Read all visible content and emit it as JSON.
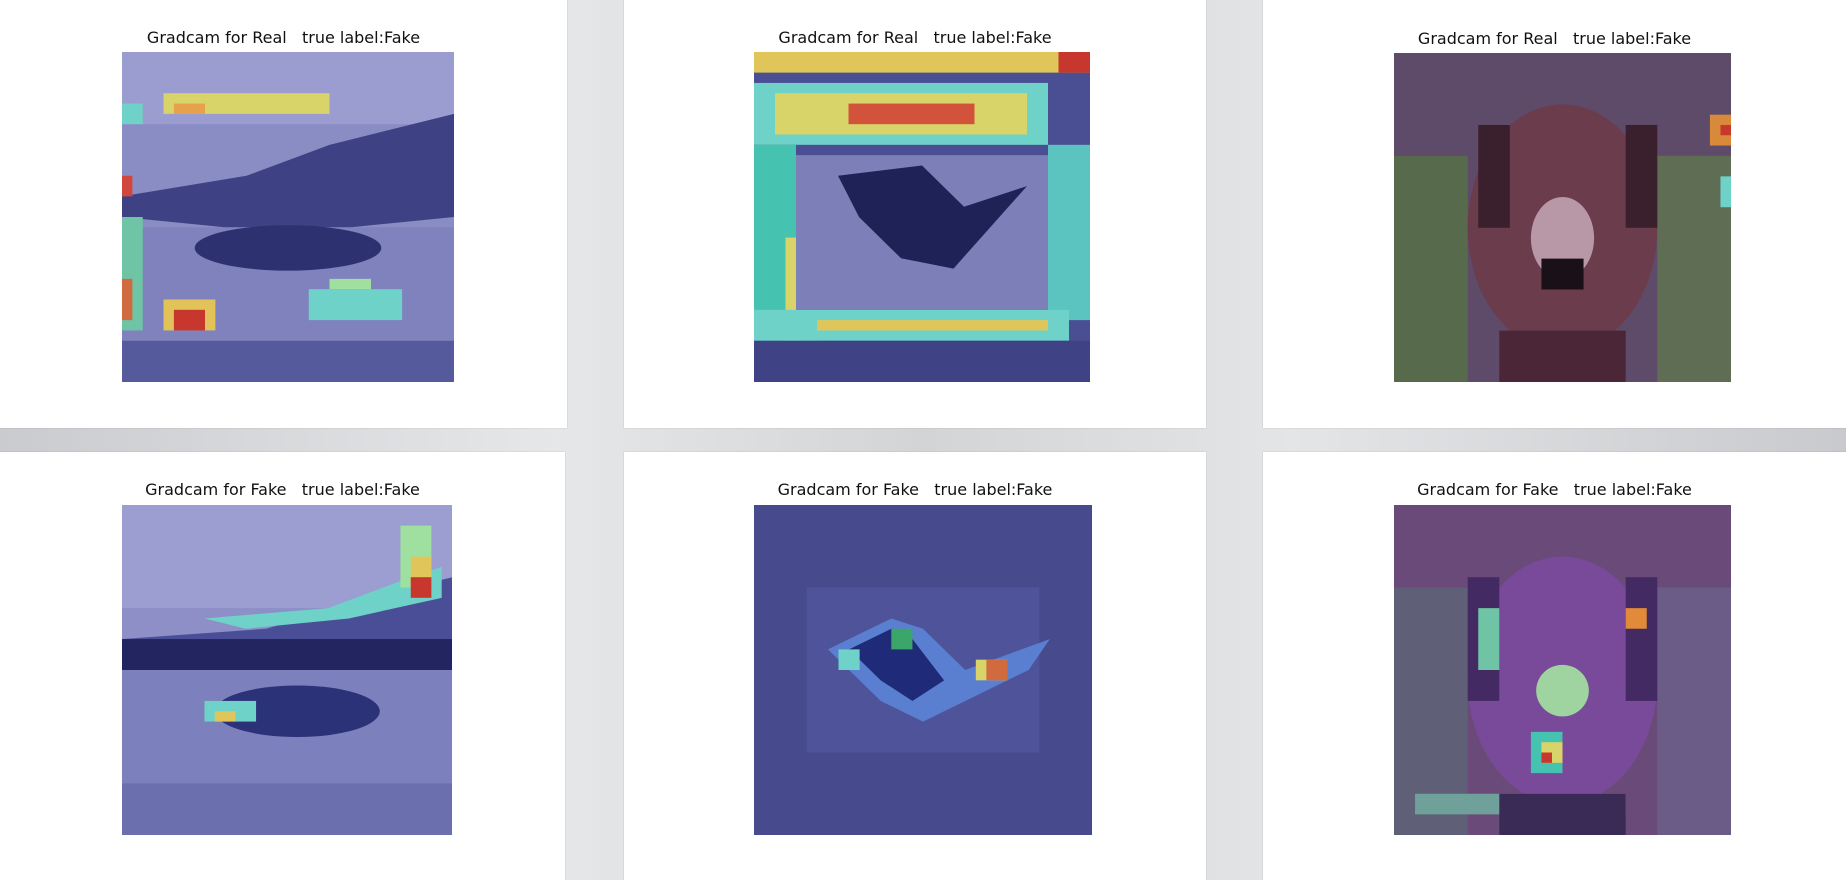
{
  "panels": [
    {
      "title": "Gradcam for Real   true label:Fake",
      "subject": "airplane",
      "mode": "real"
    },
    {
      "title": "Gradcam for Real   true label:Fake",
      "subject": "bird",
      "mode": "real"
    },
    {
      "title": "Gradcam for Real   true label:Fake",
      "subject": "dog",
      "mode": "real"
    },
    {
      "title": "Gradcam for Fake   true label:Fake",
      "subject": "airplane",
      "mode": "fake"
    },
    {
      "title": "Gradcam for Fake   true label:Fake",
      "subject": "bird",
      "mode": "fake"
    },
    {
      "title": "Gradcam for Fake   true label:Fake",
      "subject": "dog",
      "mode": "fake"
    }
  ],
  "colors": {
    "page_bg": "#d4d6d8",
    "panel_bg": "#ffffff",
    "heat_low": "#3a3f8c",
    "heat_mid": "#45c2b0",
    "heat_high": "#e9e25a",
    "heat_peak": "#c8372e"
  }
}
